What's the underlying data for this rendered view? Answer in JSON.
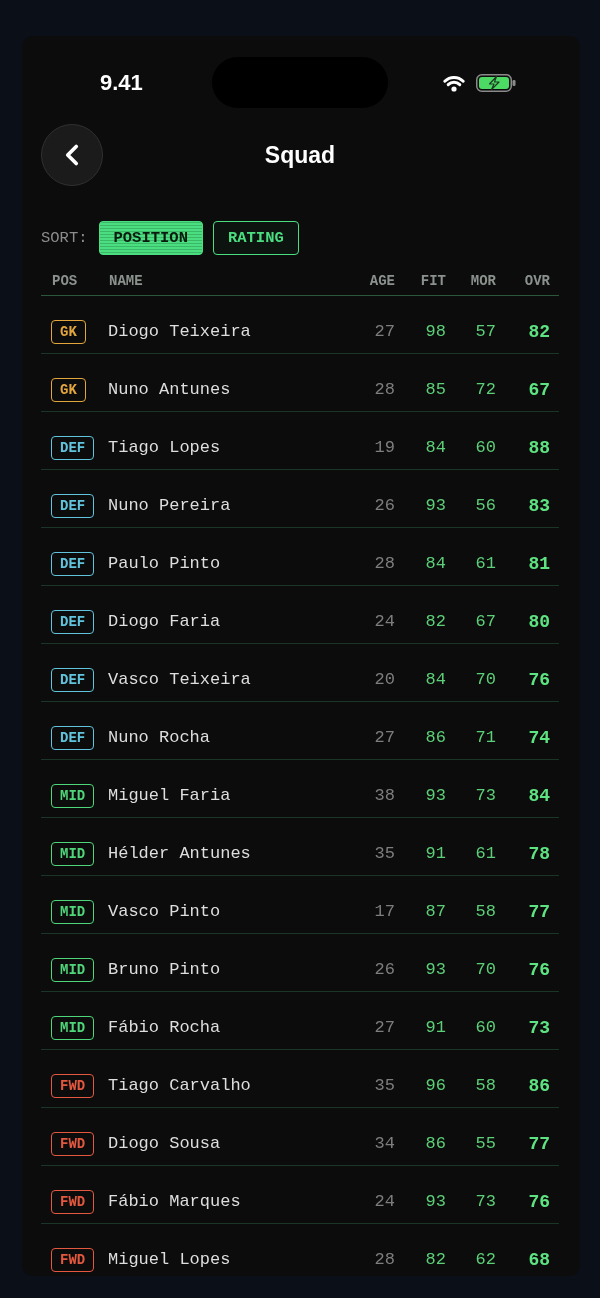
{
  "status_bar": {
    "time": "9.41"
  },
  "header": {
    "title": "Squad"
  },
  "sort": {
    "label": "SORT:",
    "options": [
      {
        "label": "POSITION",
        "selected": true
      },
      {
        "label": "RATING",
        "selected": false
      }
    ]
  },
  "table": {
    "columns": [
      "POS",
      "NAME",
      "AGE",
      "FIT",
      "MOR",
      "OVR"
    ],
    "rows": [
      {
        "position": "GK",
        "color": "#e3a63d",
        "name": "Diogo Teixeira",
        "age": "27",
        "fit": "98",
        "mor": "57",
        "ovr": "82"
      },
      {
        "position": "GK",
        "color": "#e3a63d",
        "name": "Nuno Antunes",
        "age": "28",
        "fit": "85",
        "mor": "72",
        "ovr": "67"
      },
      {
        "position": "DEF",
        "color": "#62c3dc",
        "name": "Tiago Lopes",
        "age": "19",
        "fit": "84",
        "mor": "60",
        "ovr": "88"
      },
      {
        "position": "DEF",
        "color": "#62c3dc",
        "name": "Nuno Pereira",
        "age": "26",
        "fit": "93",
        "mor": "56",
        "ovr": "83"
      },
      {
        "position": "DEF",
        "color": "#62c3dc",
        "name": "Paulo Pinto",
        "age": "28",
        "fit": "84",
        "mor": "61",
        "ovr": "81"
      },
      {
        "position": "DEF",
        "color": "#62c3dc",
        "name": "Diogo Faria",
        "age": "24",
        "fit": "82",
        "mor": "67",
        "ovr": "80"
      },
      {
        "position": "DEF",
        "color": "#62c3dc",
        "name": "Vasco Teixeira",
        "age": "20",
        "fit": "84",
        "mor": "70",
        "ovr": "76"
      },
      {
        "position": "DEF",
        "color": "#62c3dc",
        "name": "Nuno Rocha",
        "age": "27",
        "fit": "86",
        "mor": "71",
        "ovr": "74"
      },
      {
        "position": "MID",
        "color": "#4fd67a",
        "name": "Miguel Faria",
        "age": "38",
        "fit": "93",
        "mor": "73",
        "ovr": "84"
      },
      {
        "position": "MID",
        "color": "#4fd67a",
        "name": "Hélder Antunes",
        "age": "35",
        "fit": "91",
        "mor": "61",
        "ovr": "78"
      },
      {
        "position": "MID",
        "color": "#4fd67a",
        "name": "Vasco Pinto",
        "age": "17",
        "fit": "87",
        "mor": "58",
        "ovr": "77"
      },
      {
        "position": "MID",
        "color": "#4fd67a",
        "name": "Bruno Pinto",
        "age": "26",
        "fit": "93",
        "mor": "70",
        "ovr": "76"
      },
      {
        "position": "MID",
        "color": "#4fd67a",
        "name": "Fábio Rocha",
        "age": "27",
        "fit": "91",
        "mor": "60",
        "ovr": "73"
      },
      {
        "position": "FWD",
        "color": "#e4583f",
        "name": "Tiago Carvalho",
        "age": "35",
        "fit": "96",
        "mor": "58",
        "ovr": "86"
      },
      {
        "position": "FWD",
        "color": "#e4583f",
        "name": "Diogo Sousa",
        "age": "34",
        "fit": "86",
        "mor": "55",
        "ovr": "77"
      },
      {
        "position": "FWD",
        "color": "#e4583f",
        "name": "Fábio Marques",
        "age": "24",
        "fit": "93",
        "mor": "73",
        "ovr": "76"
      },
      {
        "position": "FWD",
        "color": "#e4583f",
        "name": "Miguel Lopes",
        "age": "28",
        "fit": "82",
        "mor": "62",
        "ovr": "68"
      }
    ]
  }
}
